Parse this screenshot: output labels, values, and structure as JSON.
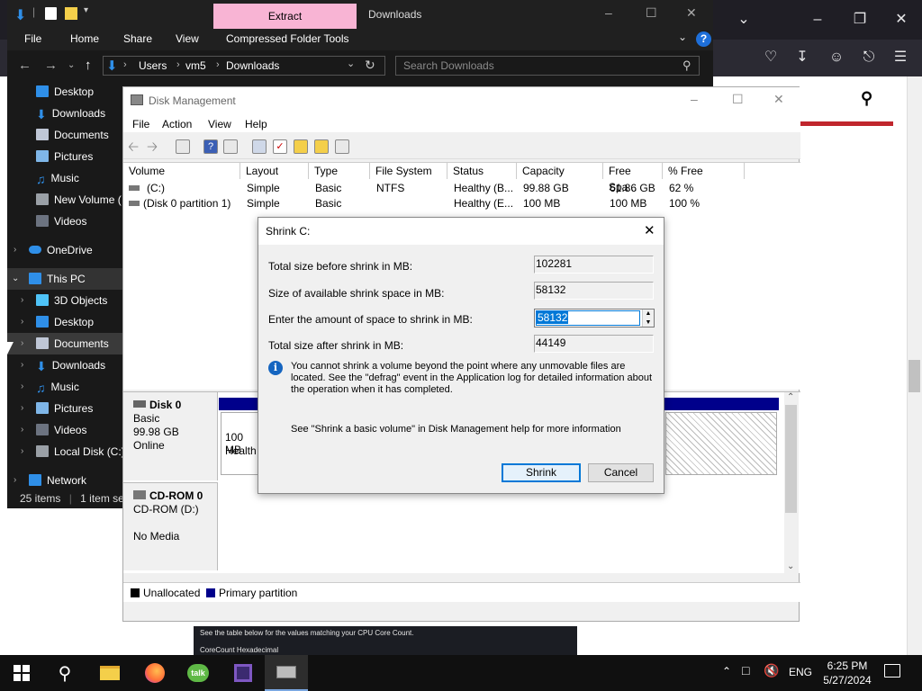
{
  "explorer": {
    "context_tab": "Extract",
    "title": "Downloads",
    "ribbon": [
      "File",
      "Home",
      "Share",
      "View",
      "Compressed Folder Tools"
    ],
    "path": [
      "Users",
      "vm5",
      "Downloads"
    ],
    "search_placeholder": "Search Downloads",
    "nav_items": [
      "Desktop",
      "Downloads",
      "Documents",
      "Pictures",
      "Music",
      "New Volume (",
      "Videos",
      "OneDrive",
      "This PC",
      "3D Objects",
      "Desktop",
      "Documents",
      "Downloads",
      "Music",
      "Pictures",
      "Videos",
      "Local Disk (C:)",
      "Network"
    ],
    "status_items": "25 items",
    "status_selected": "1 item se"
  },
  "disk_mgmt": {
    "title": "Disk Management",
    "menu": [
      "File",
      "Action",
      "View",
      "Help"
    ],
    "columns": [
      "Volume",
      "Layout",
      "Type",
      "File System",
      "Status",
      "Capacity",
      "Free Spa...",
      "% Free"
    ],
    "rows": [
      [
        "(C:)",
        "Simple",
        "Basic",
        "NTFS",
        "Healthy (B...",
        "99.88 GB",
        "61.86 GB",
        "62 %"
      ],
      [
        "(Disk 0 partition 1)",
        "Simple",
        "Basic",
        "",
        "Healthy (E...",
        "100 MB",
        "100 MB",
        "100 %"
      ]
    ],
    "disk0": {
      "name": "Disk 0",
      "type": "Basic",
      "size": "99.98 GB",
      "state": "Online",
      "part_size": "100 MB",
      "part_status": "Health"
    },
    "cdrom": {
      "name": "CD-ROM 0",
      "drive": "CD-ROM (D:)",
      "media": "No Media"
    },
    "legend": {
      "unallocated": "Unallocated",
      "primary": "Primary partition"
    }
  },
  "dialog": {
    "title": "Shrink C:",
    "total_before_label": "Total size before shrink in MB:",
    "total_before_value": "102281",
    "available_label": "Size of available shrink space in MB:",
    "available_value": "58132",
    "enter_label": "Enter the amount of space to shrink in MB:",
    "enter_value": "58132",
    "total_after_label": "Total size after shrink in MB:",
    "total_after_value": "44149",
    "info": "You cannot shrink a volume beyond the point where any unmovable files are located. See the \"defrag\" event in the Application log for detailed information about the operation when it has completed.",
    "help": "See \"Shrink a basic volume\" in Disk Management help for more information",
    "shrink_button": "Shrink",
    "cancel_button": "Cancel"
  },
  "browser_page": {
    "snippet_line1": "See the table below for the values matching your CPU Core Count.",
    "snippet_line2": "CoreCount     Hexadecimal"
  },
  "taskbar": {
    "language": "ENG",
    "time": "6:25 PM",
    "date": "5/27/2024"
  },
  "colors": {
    "accent": "#0078d7",
    "primary_partition": "#00008b",
    "context_tab": "#f8b4d4"
  }
}
